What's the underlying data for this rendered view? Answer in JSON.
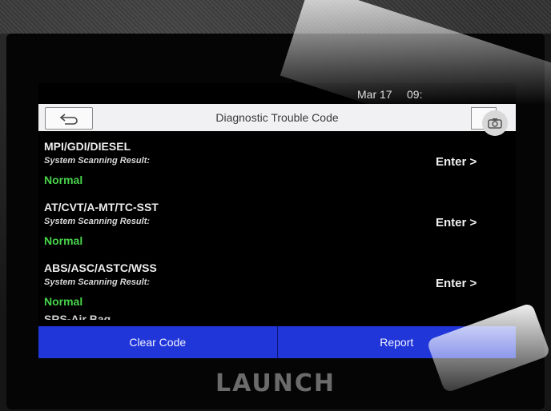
{
  "device": {
    "brand": "LAUNCH"
  },
  "status_bar": {
    "date": "Mar 17",
    "time": "09:"
  },
  "header": {
    "title": "Diagnostic Trouble Code",
    "back_icon": "back-arrow-icon",
    "screenshot_icon": "camera-icon"
  },
  "systems": [
    {
      "name": "MPI/GDI/DIESEL",
      "label": "System Scanning Result:",
      "status": "Normal",
      "action": "Enter >"
    },
    {
      "name": "AT/CVT/A-MT/TC-SST",
      "label": "System Scanning Result:",
      "status": "Normal",
      "action": "Enter >"
    },
    {
      "name": "ABS/ASC/ASTC/WSS",
      "label": "System Scanning Result:",
      "status": "Normal",
      "action": "Enter >"
    }
  ],
  "partial_item": "SRS-Air Bag",
  "footer": {
    "clear_label": "Clear Code",
    "report_label": "Report"
  },
  "colors": {
    "status_ok": "#47d34a",
    "button_bar": "#2036d9",
    "title_bar": "#f1f1f3"
  }
}
